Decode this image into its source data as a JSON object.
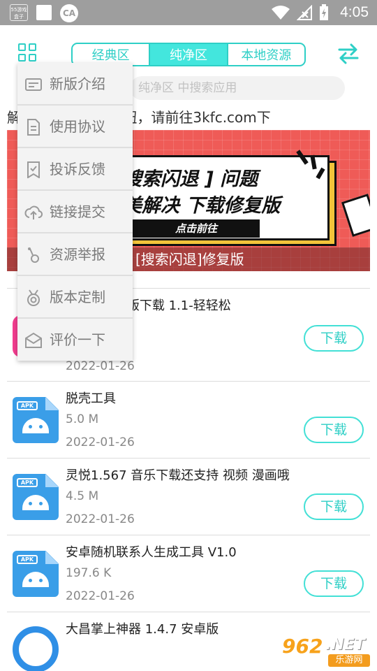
{
  "status_bar": {
    "badge_text": "55游戏\n盒子",
    "time": "4:05",
    "icons": [
      "app-badge-icon",
      "notification-square-icon",
      "ca-app-icon",
      "wifi-icon",
      "signal-icon",
      "battery-charging-icon"
    ]
  },
  "topbar": {
    "tabs": [
      {
        "label": "经典区",
        "active": false
      },
      {
        "label": "纯净区",
        "active": true
      },
      {
        "label": "本地资源",
        "active": false
      }
    ],
    "accent_color": "#2ecfc6"
  },
  "search": {
    "placeholder": "纯净区  中搜索应用"
  },
  "notice": {
    "text": "解 上角没有切换按钮，请前往3kfc.com下"
  },
  "banner": {
    "line1": "搜索闪退 ] 问题",
    "line2": "美解决  下载修复版",
    "button": "点击前往",
    "caption": "[搜索闪退]修复版"
  },
  "menu": {
    "items": [
      {
        "label": "新版介绍",
        "icon": "intro-card-icon"
      },
      {
        "label": "使用协议",
        "icon": "document-icon"
      },
      {
        "label": "投诉反馈",
        "icon": "feedback-check-icon"
      },
      {
        "label": "链接提交",
        "icon": "upload-cloud-icon"
      },
      {
        "label": "资源举报",
        "icon": "report-icon"
      },
      {
        "label": "版本定制",
        "icon": "medal-icon"
      },
      {
        "label": "评价一下",
        "icon": "mail-icon"
      }
    ]
  },
  "list": {
    "download_label": "下载",
    "items": [
      {
        "title": "人app最新版下载 1.1-轻轻松",
        "size": "",
        "date": "2022-01-26",
        "icon": "pink-app-icon"
      },
      {
        "title": "脱壳工具",
        "size": "5.0 M",
        "date": "2022-01-26",
        "icon": "apk-file-icon"
      },
      {
        "title": "灵悦1.567 音乐下载还支持 视频 漫画哦",
        "size": "4.5 M",
        "date": "2022-01-26",
        "icon": "apk-file-icon"
      },
      {
        "title": "安卓随机联系人生成工具 V1.0",
        "size": "197.6 K",
        "date": "2022-01-26",
        "icon": "apk-file-icon"
      },
      {
        "title": "大昌掌上神器 1.4.7 安卓版",
        "size": "",
        "date": "",
        "icon": "blue-ring-app-icon"
      }
    ]
  },
  "watermark": {
    "main": "962",
    "net": ".NET",
    "sub": "乐游网"
  }
}
